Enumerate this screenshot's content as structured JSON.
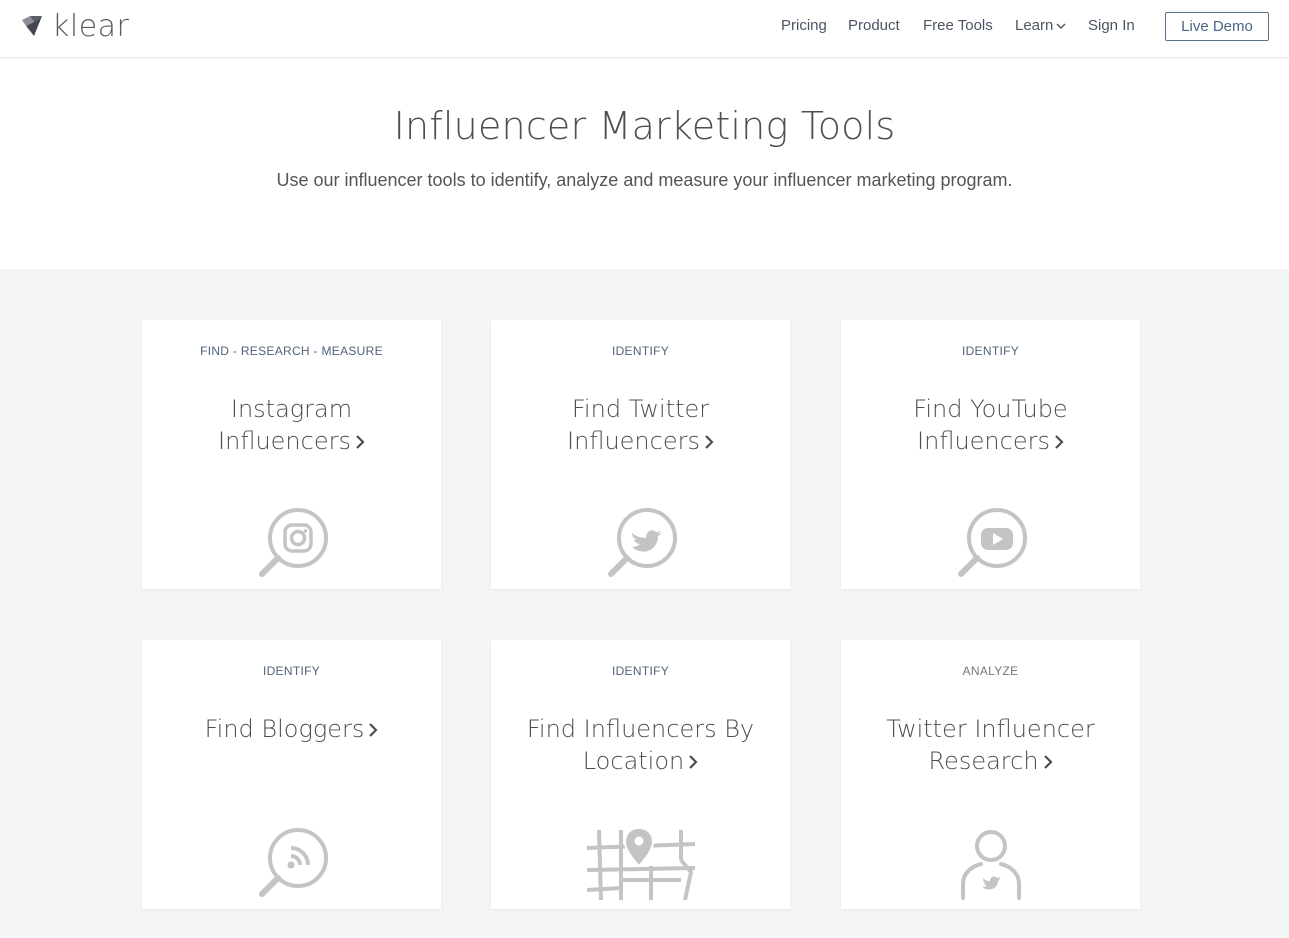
{
  "brand": {
    "name": "klear"
  },
  "nav": {
    "items": [
      "Pricing",
      "Product",
      "Free Tools",
      "Learn",
      "Sign In"
    ],
    "cta": "Live Demo"
  },
  "hero": {
    "title": "Influencer Marketing Tools",
    "subtitle": "Use our influencer tools to identify, analyze and measure your influencer marketing program."
  },
  "cards": [
    {
      "eyebrow": "FIND - RESEARCH - MEASURE",
      "line1": "Instagram",
      "line2": "Influencers",
      "icon": "instagram-search-icon"
    },
    {
      "eyebrow": "IDENTIFY",
      "line1": "Find Twitter",
      "line2": "Influencers",
      "icon": "twitter-search-icon"
    },
    {
      "eyebrow": "IDENTIFY",
      "line1": "Find YouTube",
      "line2": "Influencers",
      "icon": "youtube-search-icon"
    },
    {
      "eyebrow": "IDENTIFY",
      "line1": "Find Bloggers",
      "line2": "",
      "icon": "rss-search-icon"
    },
    {
      "eyebrow": "IDENTIFY",
      "line1": "Find Influencers By",
      "line2": "Location",
      "icon": "map-pin-icon"
    },
    {
      "eyebrow": "ANALYZE",
      "line1": "Twitter Influencer",
      "line2": "Research",
      "icon": "twitter-user-icon"
    }
  ],
  "colors": {
    "accent": "#4c6584",
    "icon": "#c4c4c4",
    "background": "#f4f5f7"
  }
}
